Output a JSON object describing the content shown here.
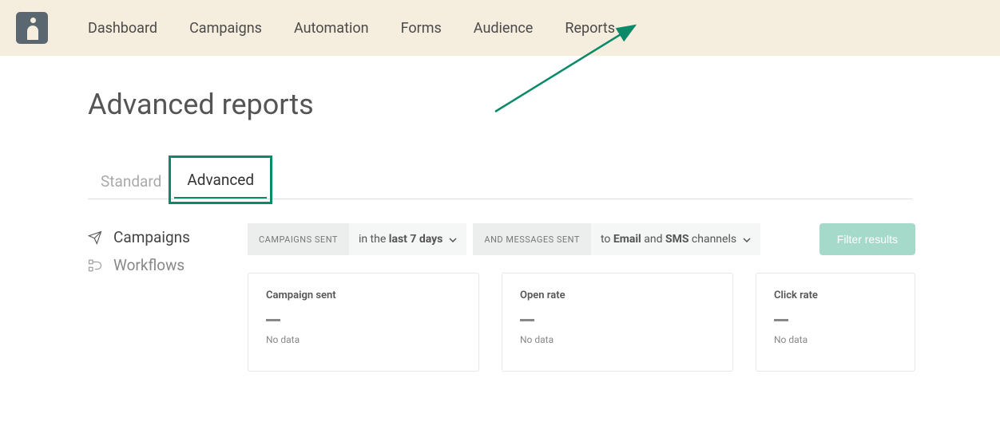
{
  "nav": {
    "items": [
      "Dashboard",
      "Campaigns",
      "Automation",
      "Forms",
      "Audience",
      "Reports"
    ]
  },
  "page": {
    "title": "Advanced reports"
  },
  "tabs": {
    "standard": "Standard",
    "advanced": "Advanced"
  },
  "sidebar": {
    "campaigns": "Campaigns",
    "workflows": "Workflows"
  },
  "filters": {
    "label1": "CAMPAIGNS SENT",
    "value1_prefix": "in the ",
    "value1_bold": "last 7 days",
    "label2": "AND MESSAGES SENT",
    "value2_prefix": "to ",
    "value2_bold1": "Email",
    "value2_mid": " and ",
    "value2_bold2": "SMS",
    "value2_suffix": " channels",
    "button": "Filter results"
  },
  "cards": [
    {
      "title": "Campaign sent",
      "nodata": "No data"
    },
    {
      "title": "Open rate",
      "nodata": "No data"
    },
    {
      "title": "Click rate",
      "nodata": "No data"
    }
  ],
  "colors": {
    "accent": "#0b8a6a",
    "topbar": "#f5eede",
    "buttonLight": "#a5d9ca"
  }
}
